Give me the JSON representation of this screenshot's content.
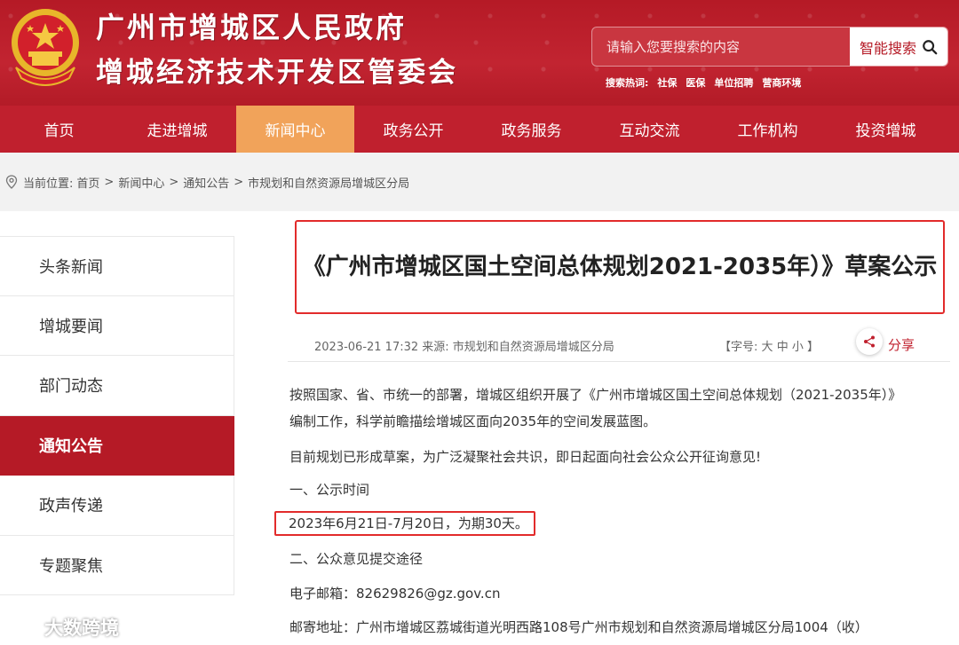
{
  "header": {
    "title_line1": "广州市增城区人民政府",
    "title_line2": "增城经济技术开发区管委会",
    "search_placeholder": "请输入您要搜索的内容",
    "search_button": "智能搜索",
    "hot_label": "搜索热词:",
    "hot_words": [
      "社保",
      "医保",
      "单位招聘",
      "营商环境"
    ],
    "brand_color": "#c0202e"
  },
  "nav": {
    "items": [
      "首页",
      "走进增城",
      "新闻中心",
      "政务公开",
      "政务服务",
      "互动交流",
      "工作机构",
      "投资增城"
    ],
    "active_index": 2
  },
  "breadcrumb": {
    "prefix": "当前位置:",
    "items": [
      "首页",
      "新闻中心",
      "通知公告",
      "市规划和自然资源局增城区分局"
    ],
    "separator": ">"
  },
  "sidebar": {
    "items": [
      "头条新闻",
      "增城要闻",
      "部门动态",
      "通知公告",
      "政声传递",
      "专题聚焦"
    ],
    "active_index": 3
  },
  "article": {
    "title": "《广州市增城区国土空间总体规划2021-2035年）》草案公示",
    "meta": "2023-06-21 17:32 来源: 市规划和自然资源局增城区分局",
    "font_label_open": "【字号:",
    "font_sizes": [
      "大",
      "中",
      "小"
    ],
    "font_label_close": "】",
    "share_label": "分享",
    "paragraphs": [
      "按照国家、省、市统一的部署，增城区组织开展了《广州市增城区国土空间总体规划（2021-2035年）》",
      "编制工作，科学前瞻描绘增城区面向2035年的空间发展蓝图。",
      "目前规划已形成草案，为广泛凝聚社会共识，即日起面向社会公众公开征询意见!",
      "一、公示时间",
      "2023年6月21日-7月20日，为期30天。",
      "二、公众意见提交途径",
      "电子邮箱：82629826@gz.gov.cn",
      "邮寄地址：广州市增城区荔城街道光明西路108号广州市规划和自然资源局增城区分局1004（收）"
    ]
  },
  "watermark": "大数跨境"
}
